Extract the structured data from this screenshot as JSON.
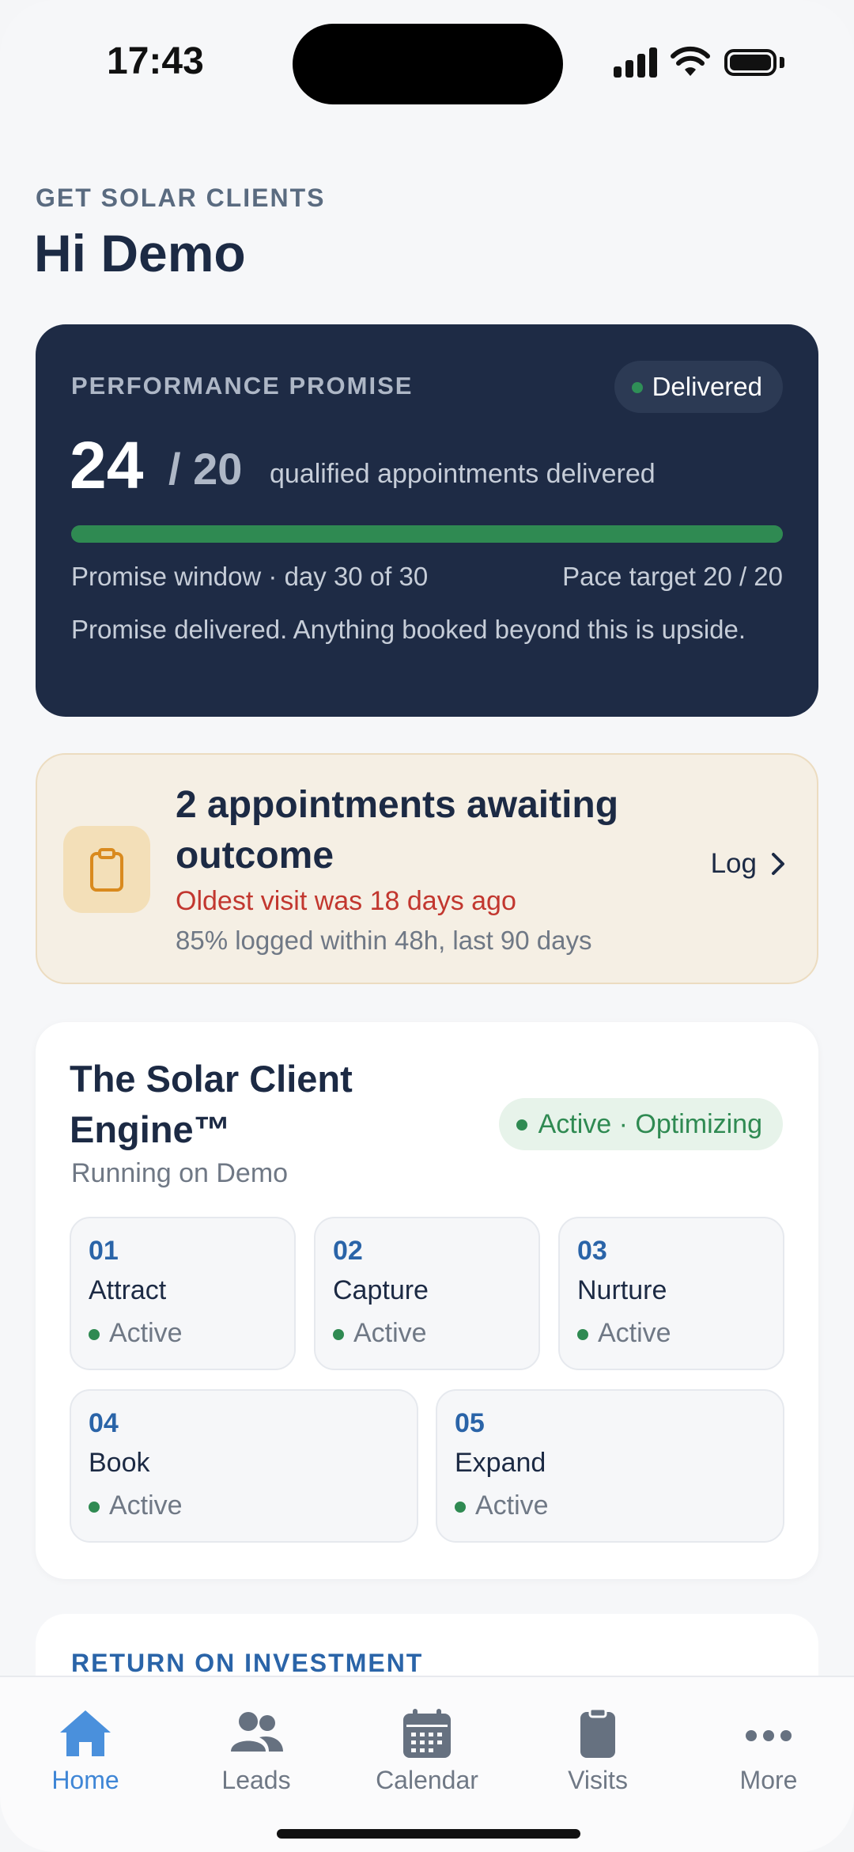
{
  "status_bar": {
    "time": "17:43"
  },
  "header": {
    "eyebrow": "GET SOLAR CLIENTS",
    "greeting": "Hi Demo"
  },
  "promise": {
    "label": "PERFORMANCE PROMISE",
    "badge": "Delivered",
    "delivered": "24",
    "target": "/ 20",
    "description": "qualified appointments delivered",
    "progress": 1.0,
    "window_text": "Promise window · day 30 of 30",
    "pace_text": "Pace target 20 / 20",
    "note": "Promise delivered. Anything booked beyond this is upside."
  },
  "awaiting": {
    "title": "2 appointments awaiting outcome",
    "warning": "Oldest visit was 18 days ago",
    "stat": "85% logged within 48h, last 90 days",
    "action_label": "Log",
    "icon": "clipboard-icon"
  },
  "engine": {
    "title": "The Solar Client Engine™",
    "subtitle": "Running on Demo",
    "badge": "Active · Optimizing",
    "stages": [
      {
        "num": "01",
        "name": "Attract",
        "status": "Active"
      },
      {
        "num": "02",
        "name": "Capture",
        "status": "Active"
      },
      {
        "num": "03",
        "name": "Nurture",
        "status": "Active"
      },
      {
        "num": "04",
        "name": "Book",
        "status": "Active"
      },
      {
        "num": "05",
        "name": "Expand",
        "status": "Active"
      }
    ]
  },
  "roi": {
    "label": "RETURN ON INVESTMENT"
  },
  "tabs": [
    {
      "label": "Home",
      "icon": "home-icon",
      "active": true
    },
    {
      "label": "Leads",
      "icon": "people-icon",
      "active": false
    },
    {
      "label": "Calendar",
      "icon": "calendar-icon",
      "active": false
    },
    {
      "label": "Visits",
      "icon": "clipboard-icon",
      "active": false
    },
    {
      "label": "More",
      "icon": "more-icon",
      "active": false
    }
  ],
  "colors": {
    "accent": "#3f86d6",
    "navy": "#1e2b45",
    "success": "#2f8a52",
    "danger": "#c2372f"
  }
}
